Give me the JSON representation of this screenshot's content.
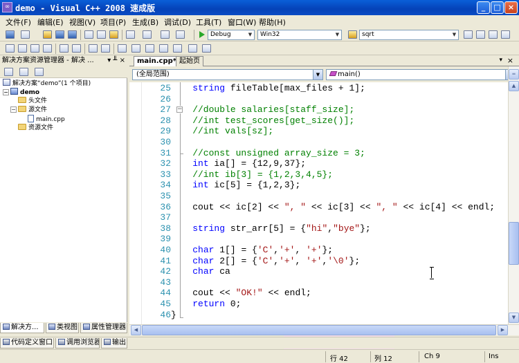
{
  "window": {
    "title": "demo - Visual C++ 2008 速成版",
    "app_icon": "vc-icon",
    "minimize": "_",
    "maximize": "□",
    "close": "×"
  },
  "menu": [
    "文件(F)",
    "编辑(E)",
    "视图(V)",
    "项目(P)",
    "生成(B)",
    "调试(D)",
    "工具(T)",
    "窗口(W)",
    "帮助(H)"
  ],
  "toolbar": {
    "config": "Debug",
    "platform": "Win32",
    "find_value": "sqrt"
  },
  "solution_explorer": {
    "title": "解决方案资源管理器 - 解决 ...",
    "pin": "▾ ╨ ×",
    "tree": [
      {
        "label": "解决方案“demo”(1 个项目)",
        "icon": "solution-icon",
        "level": 0
      },
      {
        "label": "demo",
        "icon": "project-icon",
        "level": 0
      },
      {
        "label": "头文件",
        "icon": "folder-icon",
        "level": 1
      },
      {
        "label": "源文件",
        "icon": "folder-icon",
        "level": 1
      },
      {
        "label": "main.cpp",
        "icon": "cpp-file-icon",
        "level": 2
      },
      {
        "label": "资源文件",
        "icon": "folder-icon",
        "level": 1
      }
    ],
    "tabs": [
      "解决方...",
      "类视图",
      "属性管理器"
    ]
  },
  "document_tabs": {
    "tabs": [
      "main.cpp*",
      "起始页"
    ],
    "pin": "▾",
    "close": "×"
  },
  "scope": {
    "left": "(全局范围)",
    "right": "main()"
  },
  "code_lines": [
    {
      "n": "25",
      "t": "    string fileTable[max_files + 1];",
      "c": "plain"
    },
    {
      "n": "26",
      "t": "",
      "c": "plain"
    },
    {
      "n": "27",
      "t": "    //double salaries[staff_size];",
      "c": "cmt"
    },
    {
      "n": "28",
      "t": "    //int test_scores[get_size()];",
      "c": "cmt"
    },
    {
      "n": "29",
      "t": "    //int vals[sz];",
      "c": "cmt"
    },
    {
      "n": "30",
      "t": "",
      "c": "plain"
    },
    {
      "n": "31",
      "t": "    //const unsigned array_size = 3;",
      "c": "cmt"
    },
    {
      "n": "32",
      "t": "    int ia[] = {12,9,37};",
      "c": "int"
    },
    {
      "n": "33",
      "t": "    //int ib[3] = {1,2,3,4,5};",
      "c": "cmt"
    },
    {
      "n": "34",
      "t": "    int ic[5] = {1,2,3};",
      "c": "int"
    },
    {
      "n": "35",
      "t": "",
      "c": "plain"
    },
    {
      "n": "36",
      "t": "    cout << ic[2] << \", \" << ic[3] << \", \" << ic[4] << endl;",
      "c": "cout"
    },
    {
      "n": "37",
      "t": "",
      "c": "plain"
    },
    {
      "n": "38",
      "t": "    string str_arr[5] = {\"hi\",\"bye\"};",
      "c": "strarr"
    },
    {
      "n": "39",
      "t": "",
      "c": "plain"
    },
    {
      "n": "40",
      "t": "    char ca1[] = {'C','+', '+'};",
      "c": "char"
    },
    {
      "n": "41",
      "t": "    char ca2[] = {'C','+', '+','\\0'};",
      "c": "char"
    },
    {
      "n": "42",
      "t": "    char ca",
      "c": "char"
    },
    {
      "n": "43",
      "t": "",
      "c": "plain"
    },
    {
      "n": "44",
      "t": "    cout << \"OK!\" << endl;",
      "c": "ok"
    },
    {
      "n": "45",
      "t": "    return 0;",
      "c": "ret"
    },
    {
      "n": "46",
      "t": "}",
      "c": "plain"
    }
  ],
  "bottom_tabs": [
    "代码定义窗口",
    "调用浏览器",
    "输出"
  ],
  "status": {
    "line": "行 42",
    "col": "列 12",
    "ch": "Ch 9",
    "mode": "Ins"
  }
}
